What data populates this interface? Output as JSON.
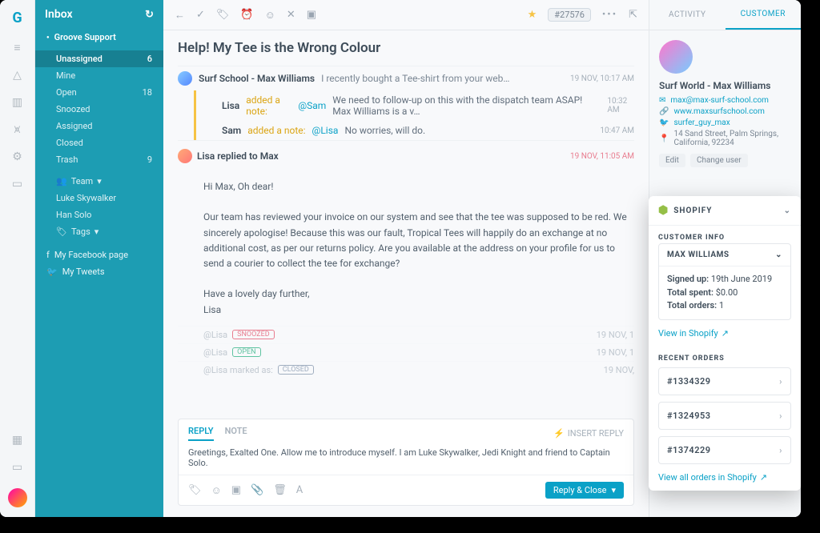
{
  "sidebar": {
    "title": "Inbox",
    "mailbox": "Groove Support",
    "items": [
      {
        "label": "Unassigned",
        "count": "6",
        "active": true
      },
      {
        "label": "Mine",
        "count": ""
      },
      {
        "label": "Open",
        "count": "18"
      },
      {
        "label": "Snoozed",
        "count": ""
      },
      {
        "label": "Assigned",
        "count": ""
      },
      {
        "label": "Closed",
        "count": ""
      },
      {
        "label": "Trash",
        "count": "9"
      }
    ],
    "team_label": "Team",
    "team": [
      {
        "label": "Luke Skywalker"
      },
      {
        "label": "Han Solo"
      }
    ],
    "tags_label": "Tags",
    "social": [
      {
        "label": "My Facebook page"
      },
      {
        "label": "My Tweets"
      }
    ]
  },
  "toolbar": {
    "ticket": "#27576"
  },
  "thread": {
    "subject": "Help! My Tee is the Wrong Colour",
    "original": {
      "from": "Surf School - Max Williams",
      "preview": "I recently bought a Tee-shirt from your web…",
      "time": "19 NOV, 10:17 AM"
    },
    "notes": [
      {
        "author": "Lisa",
        "label": "added a note:",
        "mention": "@Sam",
        "body": "We need to follow-up on this with the dispatch team ASAP! Max Williams is a v…",
        "time": "10:32 AM"
      },
      {
        "author": "Sam",
        "label": "added a note:",
        "mention": "@Lisa",
        "body": "No worries, will do.",
        "time": "10:47 AM"
      }
    ],
    "reply": {
      "head": "Lisa replied to Max",
      "time": "19 NOV, 11:05 AM",
      "greeting": "Hi Max, Oh dear!",
      "p1": "Our team has reviewed your invoice on our system and see that the tee was supposed to be red. We sincerely apologise! Because this was our fault, Tropical Tees will happily do an exchange at no additional cost, as per our returns policy. Are you available at the address on your profile for us to send a courier to collect the tee for exchange?",
      "p2": "Have a lovely day further,",
      "sign": "Lisa"
    },
    "events": [
      {
        "who": "@Lisa",
        "pill": "SNOOZED",
        "cls": "snooze",
        "time": "19 NOV, 1"
      },
      {
        "who": "@Lisa",
        "pill": "OPEN",
        "cls": "open",
        "time": "19 NOV, 1"
      },
      {
        "who": "@Lisa marked as:",
        "pill": "CLOSED",
        "cls": "closed",
        "time": "19 NOV,"
      }
    ]
  },
  "composer": {
    "reply_tab": "REPLY",
    "note_tab": "NOTE",
    "insert": "INSERT REPLY",
    "draft": "Greetings, Exalted One. Allow me to introduce myself. I am Luke Skywalker, Jedi Knight and friend to Captain Solo.",
    "send": "Reply & Close"
  },
  "right": {
    "tab_activity": "ACTIVITY",
    "tab_customer": "CUSTOMER",
    "name": "Surf World - Max Williams",
    "email": "max@max-surf-school.com",
    "site": "www.maxsurfschool.com",
    "twitter": "surfer_guy_max",
    "address": "14 Sand Street, Palm Springs, California, 92234",
    "edit": "Edit",
    "change": "Change user"
  },
  "shopify": {
    "brand": "SHOPIFY",
    "section1": "CUSTOMER INFO",
    "cust_name": "MAX WILLIAMS",
    "signed_label": "Signed up:",
    "signed_val": "19th June 2019",
    "spent_label": "Total spent:",
    "spent_val": "$0.00",
    "orders_label": "Total orders:",
    "orders_val": "1",
    "view_cust": "View in Shopify",
    "section2": "RECENT ORDERS",
    "orders": [
      {
        "id": "#1334329"
      },
      {
        "id": "#1324953"
      },
      {
        "id": "#1374229"
      }
    ],
    "view_all": "View all orders in Shopify"
  }
}
